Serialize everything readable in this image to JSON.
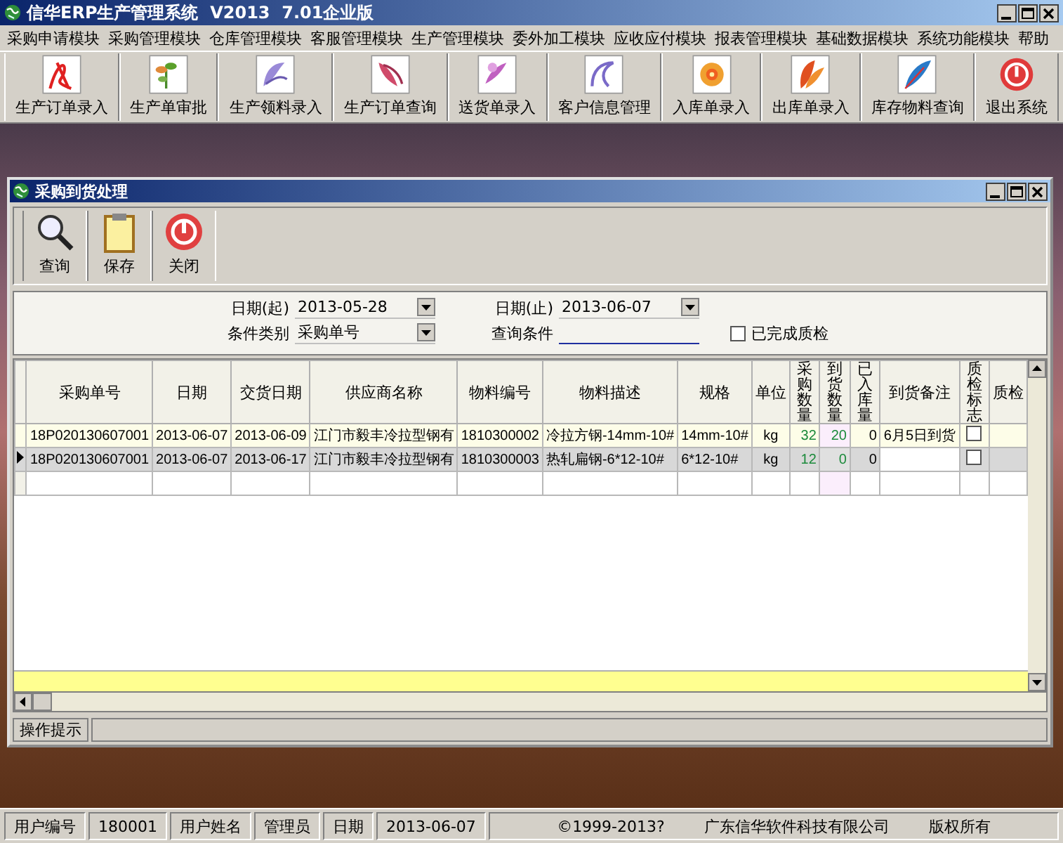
{
  "window": {
    "title": "信华ERP生产管理系统  V2013  7.01企业版"
  },
  "menu": [
    "采购申请模块",
    "采购管理模块",
    "仓库管理模块",
    "客服管理模块",
    "生产管理模块",
    "委外加工模块",
    "应收应付模块",
    "报表管理模块",
    "基础数据模块",
    "系统功能模块",
    "帮助"
  ],
  "toolbar": [
    "生产订单录入",
    "生产单审批",
    "生产领料录入",
    "生产订单查询",
    "送货单录入",
    "客户信息管理",
    "入库单录入",
    "出库单录入",
    "库存物料查询",
    "退出系统"
  ],
  "child_window": {
    "title": "采购到货处理",
    "toolbar": [
      "查询",
      "保存",
      "关闭"
    ],
    "filters": {
      "date_start": {
        "label": "日期(起)",
        "value": "2013-05-28"
      },
      "date_end": {
        "label": "日期(止)",
        "value": "2013-06-07"
      },
      "condition_type": {
        "label": "条件类别",
        "value": "采购单号"
      },
      "condition": {
        "label": "查询条件"
      },
      "completed_qc": {
        "label": "已完成质检",
        "checked": false
      }
    },
    "table": {
      "columns": [
        "采购单号",
        "日期",
        "交货日期",
        "供应商名称",
        "物料编号",
        "物料描述",
        "规格",
        "单位",
        "采购数量",
        "到货数量",
        "已入库量",
        "到货备注",
        "质检标志",
        "质检"
      ],
      "rows": [
        {
          "selected": false,
          "cells": [
            "18P020130607001",
            "2013-06-07",
            "2013-06-09",
            "江门市毅丰冷拉型钢有",
            "1810300002",
            "冷拉方钢-14mm-10#",
            "14mm-10#",
            "kg",
            "32",
            "20",
            "0",
            "6月5日到货"
          ],
          "qc_flag": false
        },
        {
          "selected": true,
          "cells": [
            "18P020130607001",
            "2013-06-07",
            "2013-06-17",
            "江门市毅丰冷拉型钢有",
            "1810300003",
            "热轧扁钢-6*12-10#",
            "6*12-10#",
            "kg",
            "12",
            "0",
            "0",
            ""
          ],
          "qc_flag": false
        }
      ]
    },
    "hint_label": "操作提示"
  },
  "status_bar": {
    "fields": [
      {
        "label": "用户编号",
        "value": "180001"
      },
      {
        "label": "用户姓名",
        "value": "管理员"
      },
      {
        "label": "日期",
        "value": "2013-06-07"
      }
    ],
    "copyright": "©1999-2013?",
    "company": "广东信华软件科技有限公司",
    "rights": "版权所有"
  }
}
